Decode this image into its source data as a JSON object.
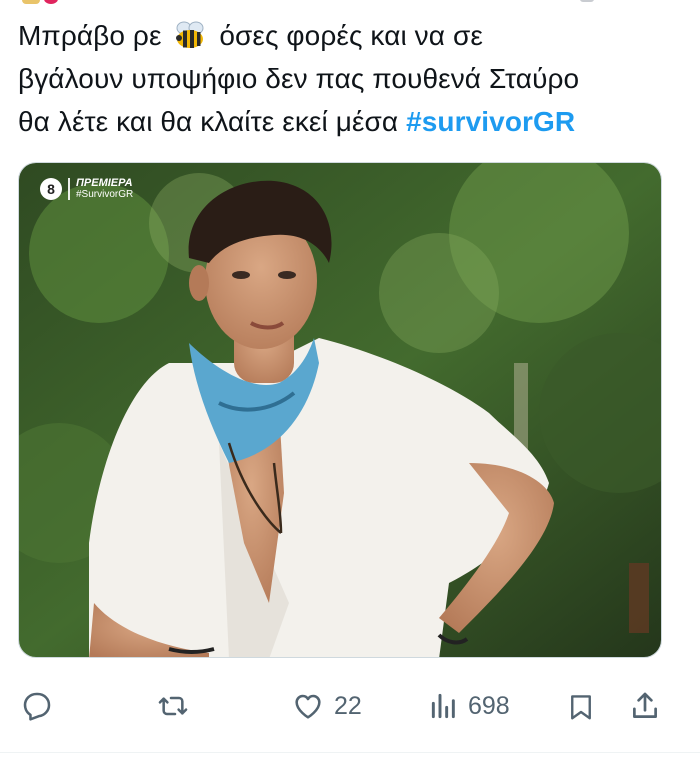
{
  "tweet": {
    "text_line1_before": "Μπράβο ρε",
    "emoji": "bee-emoji",
    "text_line1_after": "όσες φορές και να σε",
    "text_line2": "βγάλουν υποψήφιο δεν πας πουθενά  Σταύρο",
    "text_line3": "θα λέτε και θα κλαίτε εκεί μέσα",
    "hashtag": "#survivorGR"
  },
  "media": {
    "overlay_channel": "8",
    "overlay_title": "ΠΡΕΜΙΕΡΑ",
    "overlay_tag": "#SurvivorGR"
  },
  "actions": {
    "reply_icon": "reply-icon",
    "retweet_icon": "retweet-icon",
    "like_icon": "heart-icon",
    "like_count": "22",
    "views_icon": "views-chart-icon",
    "views_count": "698",
    "bookmark_icon": "bookmark-icon",
    "share_icon": "share-icon"
  },
  "colors": {
    "hashtag": "#1d9bf0",
    "action_gray": "#536471",
    "text": "#0f1419"
  }
}
